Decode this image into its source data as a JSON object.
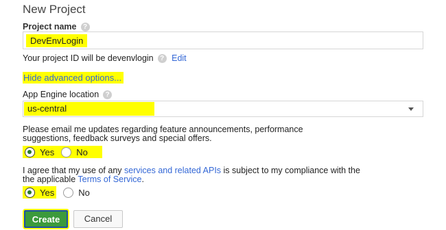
{
  "dialog": {
    "title": "New Project"
  },
  "project_name": {
    "label": "Project name",
    "help_icon": "help-icon",
    "value": "DevEnvLogin"
  },
  "project_id": {
    "prefix": "Your project ID will be devenvlogin",
    "edit_link": "Edit"
  },
  "advanced": {
    "toggle_label": "Hide advanced options..."
  },
  "app_engine": {
    "label": "App Engine location",
    "selected": "us-central"
  },
  "email_updates": {
    "text_line1": "Please email me updates regarding feature announcements, performance",
    "text_line2": "suggestions, feedback surveys and special offers.",
    "yes_label": "Yes",
    "no_label": "No",
    "selected": "Yes"
  },
  "terms": {
    "text_part1": "I agree that my use of any ",
    "services_link": "services and related APIs",
    "text_part2": " is subject to my compliance with the",
    "text_line2_prefix": "the applicable ",
    "tos_link": "Terms of Service",
    "text_line2_suffix": ".",
    "yes_label": "Yes",
    "no_label": "No",
    "selected": "Yes"
  },
  "actions": {
    "create_label": "Create",
    "cancel_label": "Cancel"
  },
  "colors": {
    "highlight": "#ffff00",
    "create_button": "#3c9a3c",
    "link": "#3367d6"
  }
}
